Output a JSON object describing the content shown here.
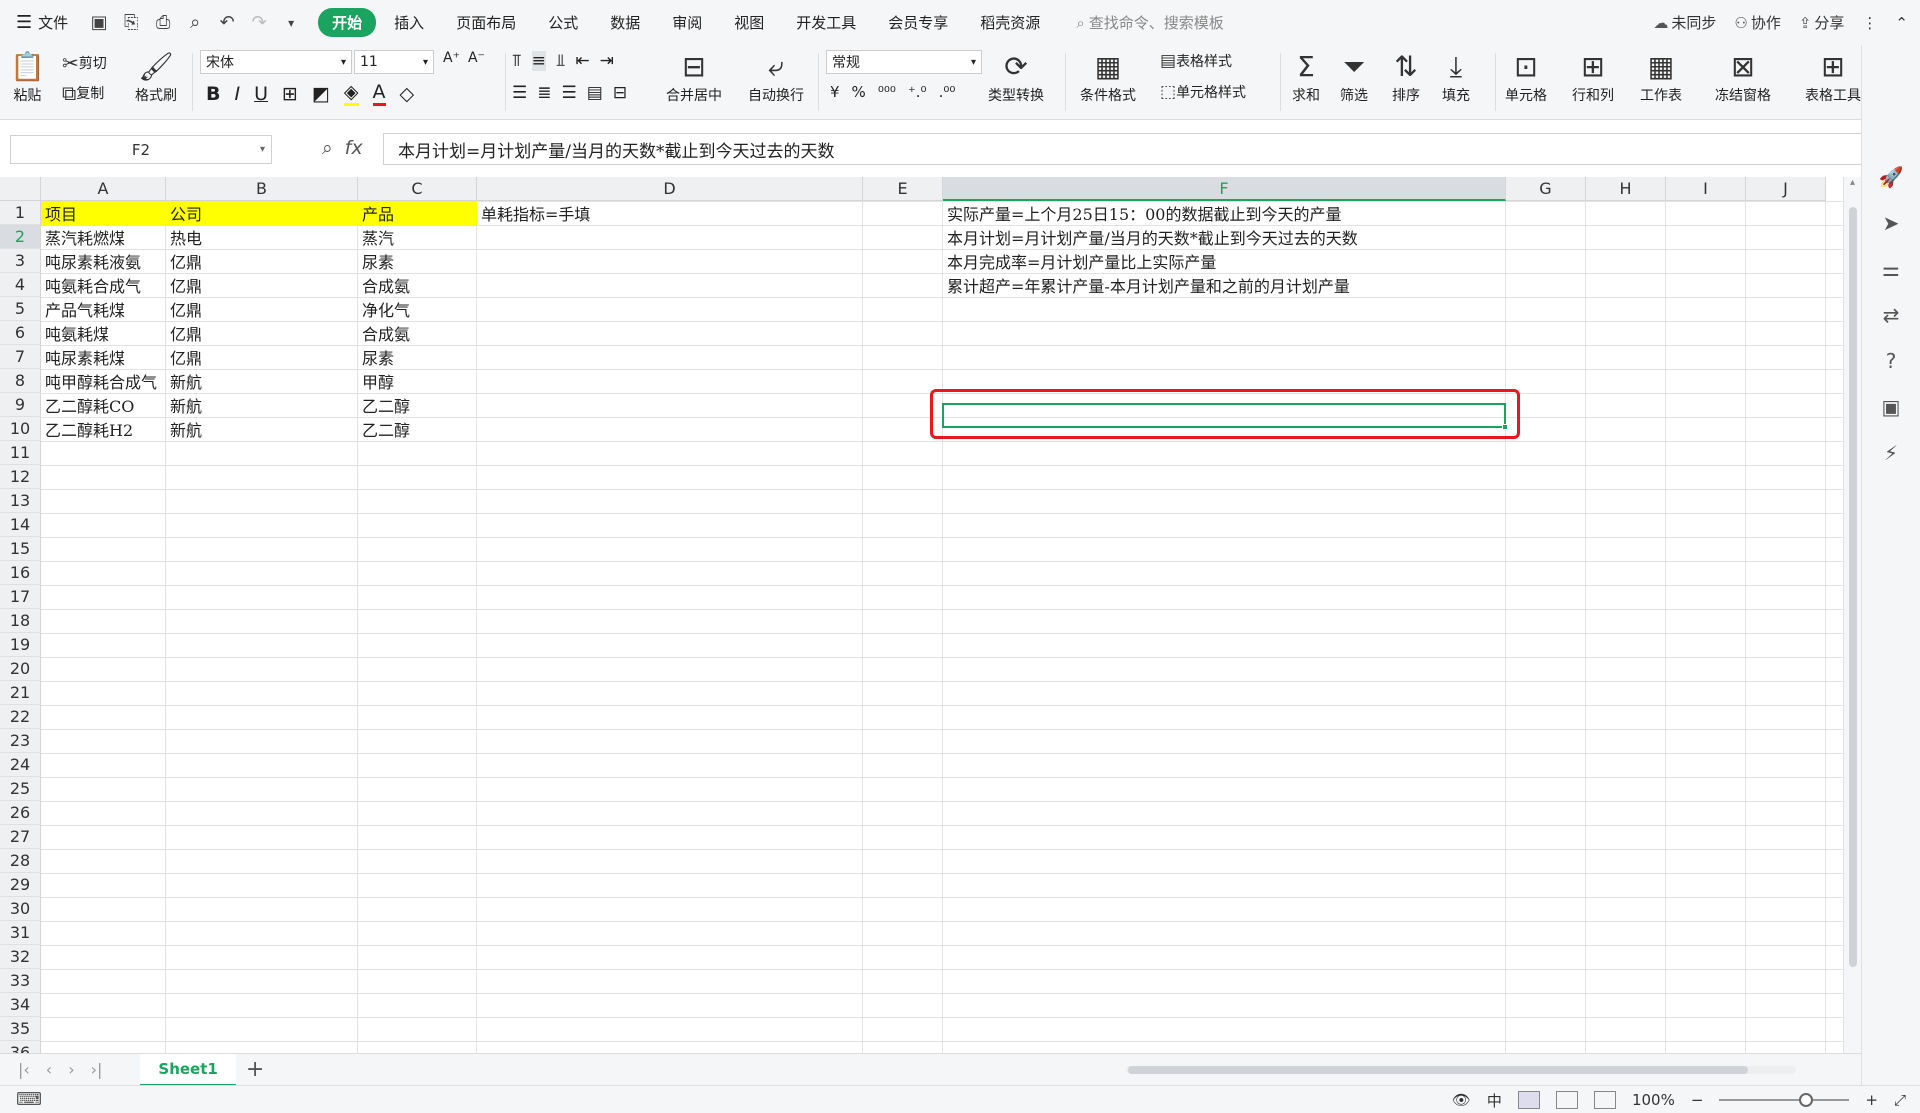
{
  "menubar": {
    "file_label": "文件",
    "tabs": [
      "开始",
      "插入",
      "页面布局",
      "公式",
      "数据",
      "审阅",
      "视图",
      "开发工具",
      "会员专享",
      "稻壳资源"
    ],
    "active_tab": "开始",
    "search_placeholder": "查找命令、搜索模板",
    "sync_label": "未同步",
    "collab_label": "协作",
    "share_label": "分享"
  },
  "ribbon": {
    "paste": "粘贴",
    "cut": "剪切",
    "copy": "复制",
    "format_painter": "格式刷",
    "font_name": "宋体",
    "font_size": "11",
    "number_format": "常规",
    "merge_center": "合并居中",
    "wrap_text": "自动换行",
    "type_convert": "类型转换",
    "cond_format": "条件格式",
    "table_style": "表格样式",
    "cell_style": "单元格样式",
    "sum": "求和",
    "filter": "筛选",
    "sort": "排序",
    "fill": "填充",
    "cell": "单元格",
    "row_col": "行和列",
    "worksheet": "工作表",
    "freeze": "冻结窗格",
    "table_tools": "表格工具"
  },
  "formula": {
    "name_box": "F2",
    "content": "本月计划=月计划产量/当月的天数*截止到今天过去的天数"
  },
  "columns": [
    "A",
    "B",
    "C",
    "D",
    "E",
    "F",
    "G",
    "H",
    "I",
    "J"
  ],
  "selected_column": "F",
  "selected_row": "2",
  "rows": [
    "1",
    "2",
    "3",
    "4",
    "5",
    "6",
    "7",
    "8",
    "9",
    "10",
    "11",
    "12",
    "13",
    "14",
    "15",
    "16",
    "17",
    "18",
    "19",
    "20",
    "21",
    "22",
    "23",
    "24",
    "25",
    "26",
    "27",
    "28",
    "29",
    "30",
    "31",
    "32",
    "33",
    "34",
    "35",
    "36"
  ],
  "cells": {
    "A": [
      "项目",
      "蒸汽耗燃煤",
      "吨尿素耗液氨",
      "吨氨耗合成气",
      "产品气耗煤",
      "吨氨耗煤",
      "吨尿素耗煤",
      "吨甲醇耗合成气",
      "乙二醇耗CO",
      "乙二醇耗H2"
    ],
    "B": [
      "公司",
      "热电",
      "亿鼎",
      "亿鼎",
      "亿鼎",
      "亿鼎",
      "亿鼎",
      "新航",
      "新航",
      "新航"
    ],
    "C": [
      "产品",
      "蒸汽",
      "尿素",
      "合成氨",
      "净化气",
      "合成氨",
      "尿素",
      "甲醇",
      "乙二醇",
      "乙二醇"
    ],
    "D1": "单耗指标=手填",
    "F": [
      "实际产量=上个月25日15：00的数据截止到今天的产量",
      "本月计划=月计划产量/当月的天数*截止到今天过去的天数",
      "本月完成率=月计划产量比上实际产量",
      "累计超产=年累计产量-本月计划产量和之前的月计划产量"
    ]
  },
  "sheets": [
    "Sheet1"
  ],
  "status": {
    "zoom": "100%"
  },
  "colors": {
    "accent": "#1aa45f",
    "highlight": "#ffff00",
    "annotation": "#e8191c"
  }
}
